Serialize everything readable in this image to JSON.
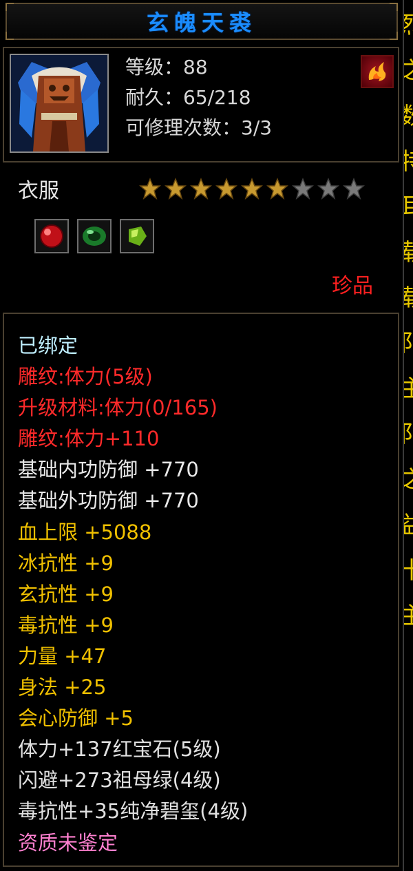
{
  "title": "玄魄天裘",
  "item": {
    "icon": "fur-armor-icon",
    "level_label": "等级：88",
    "durability_label": "耐久：65/218",
    "repair_label": "可修理次数：3/3",
    "type": "衣服",
    "stars_total": 9,
    "stars_filled": 6,
    "gems": [
      "ruby-gem-icon",
      "emerald-gem-icon",
      "jade-gem-icon"
    ],
    "rarity": "珍品"
  },
  "attributes": [
    {
      "text": "已绑定",
      "color": "cyan"
    },
    {
      "text": "雕纹:体力(5级)",
      "color": "red"
    },
    {
      "text": "升级材料:体力(0/165)",
      "color": "red"
    },
    {
      "text": "雕纹:体力+110",
      "color": "red"
    },
    {
      "text": "基础内功防御 +770",
      "color": "gray"
    },
    {
      "text": "基础外功防御 +770",
      "color": "gray"
    },
    {
      "text": "血上限 +5088",
      "color": "gold"
    },
    {
      "text": "冰抗性 +9",
      "color": "gold"
    },
    {
      "text": "玄抗性 +9",
      "color": "gold"
    },
    {
      "text": "毒抗性 +9",
      "color": "gold"
    },
    {
      "text": "力量 +47",
      "color": "gold"
    },
    {
      "text": "身法 +25",
      "color": "gold"
    },
    {
      "text": "会心防御 +5",
      "color": "gold"
    },
    {
      "text": "体力+137红宝石(5级)",
      "color": "white"
    },
    {
      "text": "闪避+273祖母绿(4级)",
      "color": "white"
    },
    {
      "text": "毒抗性+35纯净碧玺(4级)",
      "color": "white"
    },
    {
      "text": "资质未鉴定",
      "color": "pink"
    }
  ],
  "side_strip_chars": [
    "烈",
    "之",
    "数",
    "特",
    "耳",
    "载",
    "载",
    "阝",
    "主",
    "阝",
    "之",
    "益",
    "十",
    "主"
  ],
  "colors": {
    "title": "#1a8cff",
    "red": "#ff2a2a",
    "gold": "#f0c000",
    "pink": "#ff80d0",
    "cyan": "#bfefff"
  }
}
